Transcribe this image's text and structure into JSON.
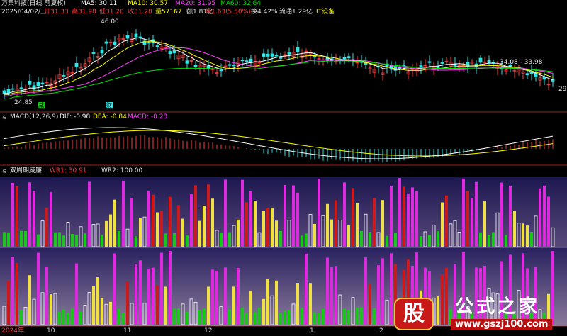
{
  "header": {
    "stock_title": "万集科技(日线 前复权)",
    "ma5": "MA5: 30.11",
    "ma10": "MA10: 30.57",
    "ma20": "MA20: 31.95",
    "ma60": "MA60: 32.64",
    "date": "2025/04/02/三",
    "open": "开31.33",
    "high": "高31.98",
    "low": "低31.20",
    "close": "收31.28",
    "volume": "量57167",
    "amount": "额1.81亿",
    "change": "幅1.63(5.50%)",
    "turnover": "换4.42%",
    "float_cap": "流通1.29亿",
    "sector": "IT设备"
  },
  "price_panel": {
    "label_high": "46.00",
    "label_low": "24.85",
    "label_range": "34.08 - 33.98",
    "label_right": "29",
    "tag_1": "减",
    "tag_2": "财"
  },
  "macd_panel": {
    "title": "MACD(12,26,9)",
    "dif": "DIF: -0.98",
    "dea": "DEA: -0.84",
    "macd": "MACD: -0.28"
  },
  "wr_panel": {
    "title": "双周期威廉",
    "wr1": "WR1: 30.91",
    "wr2": "WR2: 100.00"
  },
  "xaxis": {
    "labels": [
      "2024年",
      "10",
      "11",
      "12",
      "1",
      "2"
    ]
  },
  "watermark": {
    "logo_char": "股",
    "site_name": "公式之家",
    "url": "www.gszj100.com"
  },
  "colors": {
    "up": "#ff3c3c",
    "down": "#2ee6e6",
    "ma5": "#ffffff",
    "ma10": "#ffff00",
    "ma20": "#ff40ff",
    "ma60": "#00e000",
    "magenta_bar": "#e028e0",
    "red_bar": "#d01818",
    "yellow_bar": "#f0e040",
    "green_bar": "#18c818"
  }
}
